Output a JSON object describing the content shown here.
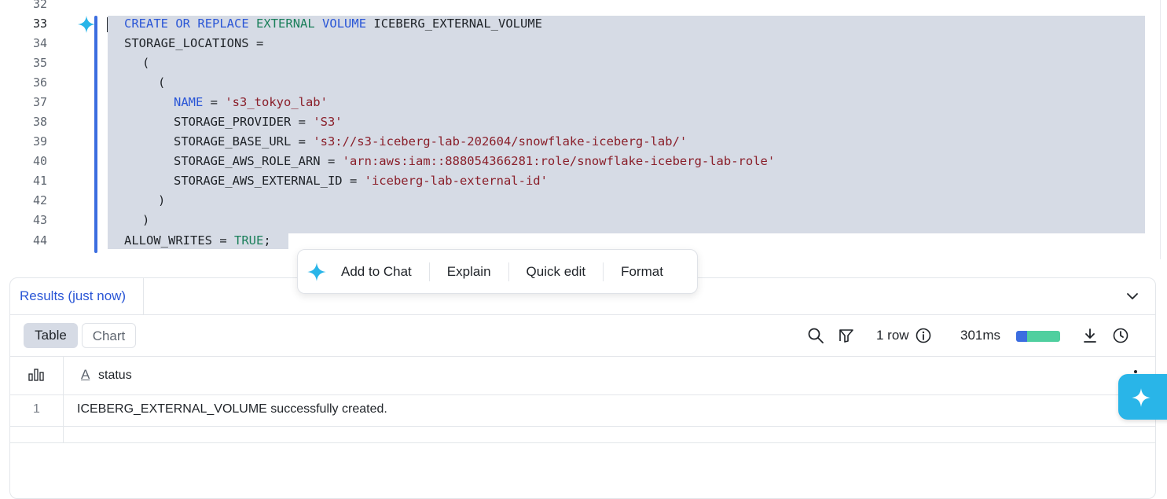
{
  "editor": {
    "lines": [
      {
        "n": "32",
        "code": ""
      },
      {
        "n": "33",
        "code": "CREATE OR REPLACE EXTERNAL VOLUME ICEBERG_EXTERNAL_VOLUME"
      },
      {
        "n": "34",
        "code": "STORAGE_LOCATIONS ="
      },
      {
        "n": "35",
        "code": "  ("
      },
      {
        "n": "36",
        "code": "    ("
      },
      {
        "n": "37",
        "code": "      NAME = 's3_tokyo_lab'"
      },
      {
        "n": "38",
        "code": "      STORAGE_PROVIDER = 'S3'"
      },
      {
        "n": "39",
        "code": "      STORAGE_BASE_URL = 's3://s3-iceberg-lab-202604/snowflake-iceberg-lab/'"
      },
      {
        "n": "40",
        "code": "      STORAGE_AWS_ROLE_ARN = 'arn:aws:iam::888054366281:role/snowflake-iceberg-lab-role'"
      },
      {
        "n": "41",
        "code": "      STORAGE_AWS_EXTERNAL_ID = 'iceberg-lab-external-id'"
      },
      {
        "n": "42",
        "code": "    )"
      },
      {
        "n": "43",
        "code": "  )"
      },
      {
        "n": "44",
        "code": "ALLOW_WRITES = TRUE;"
      }
    ],
    "tokens": {
      "l33": {
        "create": "CREATE",
        "or": "OR",
        "replace": "REPLACE",
        "external": "EXTERNAL",
        "volume": "VOLUME",
        "name": "ICEBERG_EXTERNAL_VOLUME"
      },
      "l34": "STORAGE_LOCATIONS =",
      "l35": "(",
      "l36": "(",
      "l37": {
        "key": "NAME",
        "eq": " = ",
        "val": "'s3_tokyo_lab'"
      },
      "l38": {
        "key": "STORAGE_PROVIDER = ",
        "val": "'S3'"
      },
      "l39": {
        "key": "STORAGE_BASE_URL = ",
        "val": "'s3://s3-iceberg-lab-202604/snowflake-iceberg-lab/'"
      },
      "l40": {
        "key": "STORAGE_AWS_ROLE_ARN = ",
        "val": "'arn:aws:iam::888054366281:role/snowflake-iceberg-lab-role'"
      },
      "l41": {
        "key": "STORAGE_AWS_EXTERNAL_ID = ",
        "val": "'iceberg-lab-external-id'"
      },
      "l42": ")",
      "l43": ")",
      "l44": {
        "key": "ALLOW_WRITES = ",
        "val": "TRUE",
        "end": ";"
      }
    }
  },
  "ai_toolbar": {
    "icon": "sparkle-icon",
    "add_to_chat": "Add to Chat",
    "explain": "Explain",
    "quick_edit": "Quick edit",
    "format": "Format"
  },
  "results": {
    "tab_label": "Results (just now)",
    "views": {
      "table": "Table",
      "chart": "Chart"
    },
    "row_count": "1 row",
    "duration": "301ms",
    "columns": [
      {
        "type_icon": "A",
        "name": "status"
      }
    ],
    "rows": [
      {
        "num": "1",
        "status": "ICEBERG_EXTERNAL_VOLUME successfully created."
      }
    ]
  },
  "colors": {
    "accent": "#2a56d6",
    "selection": "#d6dbe5",
    "sparkle": "#29b5e8",
    "bar_blue": "#3b6de0",
    "bar_green": "#4fcf9f"
  }
}
